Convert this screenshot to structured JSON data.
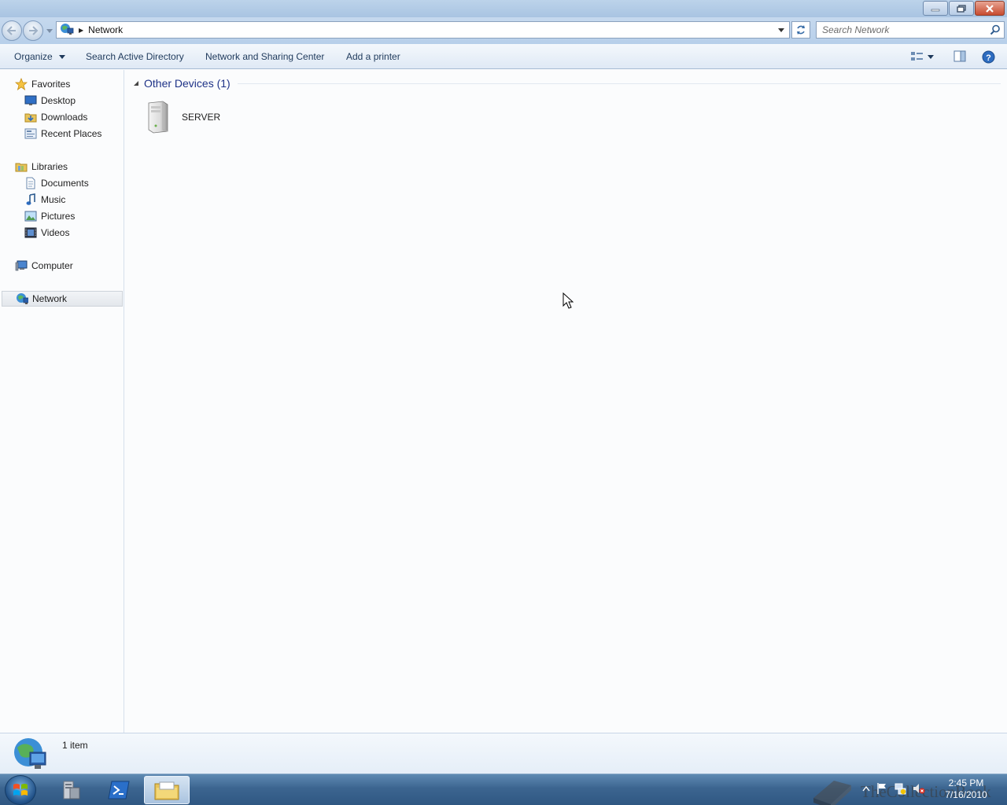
{
  "window": {
    "caption_buttons": [
      "minimize",
      "restore",
      "close"
    ]
  },
  "address": {
    "crumb": "Network",
    "search_placeholder": "Search Network"
  },
  "commandbar": {
    "organize": "Organize",
    "search_ad": "Search Active Directory",
    "sharing_center": "Network and Sharing Center",
    "add_printer": "Add a printer"
  },
  "navpane": {
    "favorites": "Favorites",
    "desktop": "Desktop",
    "downloads": "Downloads",
    "recent": "Recent Places",
    "libraries": "Libraries",
    "documents": "Documents",
    "music": "Music",
    "pictures": "Pictures",
    "videos": "Videos",
    "computer": "Computer",
    "network": "Network"
  },
  "content": {
    "group_title": "Other Devices (1)",
    "device_name": "SERVER"
  },
  "details": {
    "item_count": "1 item"
  },
  "taskbar": {
    "time": "2:45 PM",
    "date": "7/16/2010",
    "watermark": "TheCollectionBook"
  },
  "colors": {
    "accent_blue": "#1e3287",
    "taskbar": "#3c6590",
    "selection": "#e3e7ec"
  }
}
